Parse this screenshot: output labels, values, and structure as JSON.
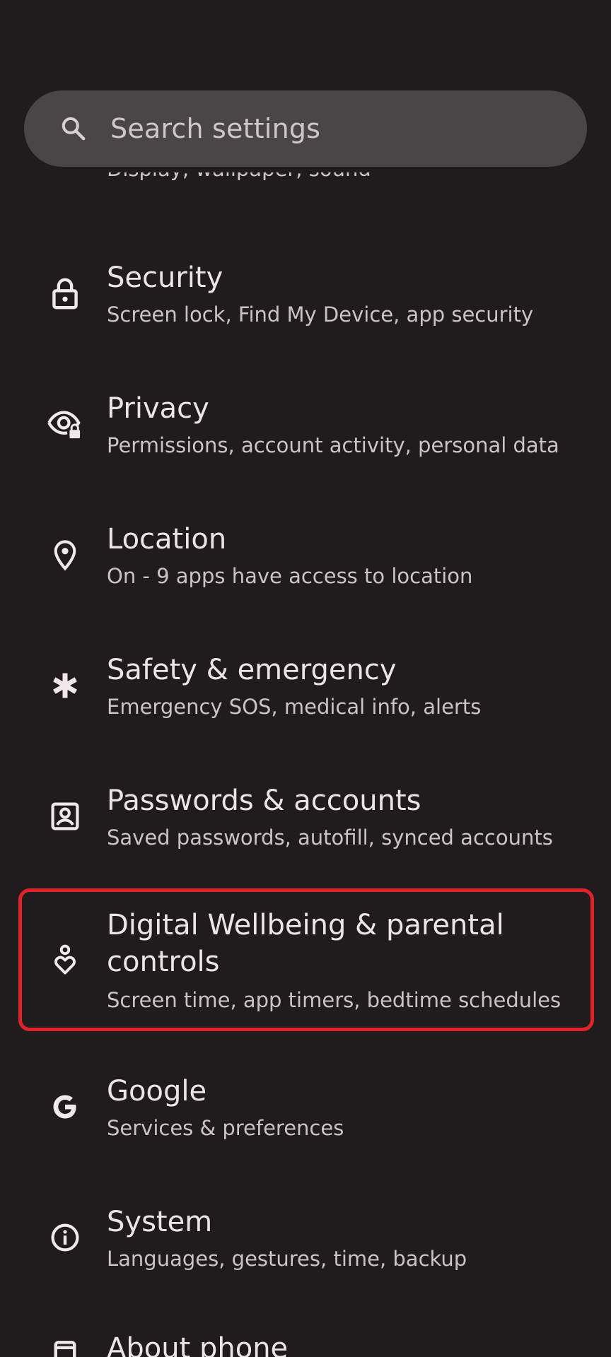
{
  "search": {
    "placeholder": "Search settings",
    "icon": "search-icon"
  },
  "partial_item": {
    "subtitle": "Display, wallpaper, sound"
  },
  "items": [
    {
      "title": "Security",
      "subtitle": "Screen lock, Find My Device, app security",
      "icon": "lock-icon"
    },
    {
      "title": "Privacy",
      "subtitle": "Permissions, account activity, personal data",
      "icon": "privacy-eye-icon"
    },
    {
      "title": "Location",
      "subtitle": "On - 9 apps have access to location",
      "icon": "location-pin-icon"
    },
    {
      "title": "Safety & emergency",
      "subtitle": "Emergency SOS, medical info, alerts",
      "icon": "asterisk-icon"
    },
    {
      "title": "Passwords & accounts",
      "subtitle": "Saved passwords, autofill, synced accounts",
      "icon": "account-box-icon"
    },
    {
      "title": "Digital Wellbeing & parental",
      "title_line2": "controls",
      "subtitle": "Screen time, app timers, bedtime schedules",
      "icon": "wellbeing-icon"
    },
    {
      "title": "Google",
      "subtitle": "Services & preferences",
      "icon": "google-icon"
    },
    {
      "title": "System",
      "subtitle": "Languages, gestures, time, backup",
      "icon": "info-icon"
    },
    {
      "title": "About phone",
      "icon": "phone-icon"
    }
  ],
  "colors": {
    "background": "#201c1e",
    "search_bar": "#4a4546",
    "highlight_border": "#e0222b"
  }
}
